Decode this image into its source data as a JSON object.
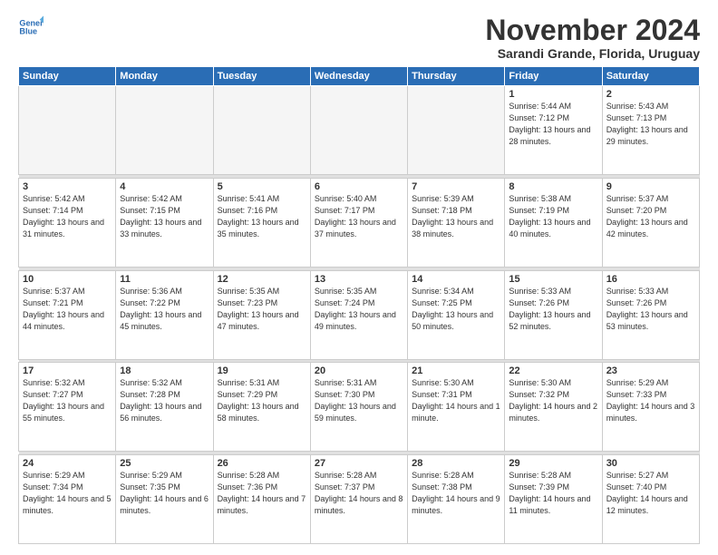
{
  "logo": {
    "line1": "General",
    "line2": "Blue"
  },
  "title": "November 2024",
  "subtitle": "Sarandi Grande, Florida, Uruguay",
  "weekdays": [
    "Sunday",
    "Monday",
    "Tuesday",
    "Wednesday",
    "Thursday",
    "Friday",
    "Saturday"
  ],
  "weeks": [
    [
      {
        "day": "",
        "empty": true
      },
      {
        "day": "",
        "empty": true
      },
      {
        "day": "",
        "empty": true
      },
      {
        "day": "",
        "empty": true
      },
      {
        "day": "",
        "empty": true
      },
      {
        "day": "1",
        "sunrise": "5:44 AM",
        "sunset": "7:12 PM",
        "daylight": "13 hours and 28 minutes."
      },
      {
        "day": "2",
        "sunrise": "5:43 AM",
        "sunset": "7:13 PM",
        "daylight": "13 hours and 29 minutes."
      }
    ],
    [
      {
        "day": "3",
        "sunrise": "5:42 AM",
        "sunset": "7:14 PM",
        "daylight": "13 hours and 31 minutes."
      },
      {
        "day": "4",
        "sunrise": "5:42 AM",
        "sunset": "7:15 PM",
        "daylight": "13 hours and 33 minutes."
      },
      {
        "day": "5",
        "sunrise": "5:41 AM",
        "sunset": "7:16 PM",
        "daylight": "13 hours and 35 minutes."
      },
      {
        "day": "6",
        "sunrise": "5:40 AM",
        "sunset": "7:17 PM",
        "daylight": "13 hours and 37 minutes."
      },
      {
        "day": "7",
        "sunrise": "5:39 AM",
        "sunset": "7:18 PM",
        "daylight": "13 hours and 38 minutes."
      },
      {
        "day": "8",
        "sunrise": "5:38 AM",
        "sunset": "7:19 PM",
        "daylight": "13 hours and 40 minutes."
      },
      {
        "day": "9",
        "sunrise": "5:37 AM",
        "sunset": "7:20 PM",
        "daylight": "13 hours and 42 minutes."
      }
    ],
    [
      {
        "day": "10",
        "sunrise": "5:37 AM",
        "sunset": "7:21 PM",
        "daylight": "13 hours and 44 minutes."
      },
      {
        "day": "11",
        "sunrise": "5:36 AM",
        "sunset": "7:22 PM",
        "daylight": "13 hours and 45 minutes."
      },
      {
        "day": "12",
        "sunrise": "5:35 AM",
        "sunset": "7:23 PM",
        "daylight": "13 hours and 47 minutes."
      },
      {
        "day": "13",
        "sunrise": "5:35 AM",
        "sunset": "7:24 PM",
        "daylight": "13 hours and 49 minutes."
      },
      {
        "day": "14",
        "sunrise": "5:34 AM",
        "sunset": "7:25 PM",
        "daylight": "13 hours and 50 minutes."
      },
      {
        "day": "15",
        "sunrise": "5:33 AM",
        "sunset": "7:26 PM",
        "daylight": "13 hours and 52 minutes."
      },
      {
        "day": "16",
        "sunrise": "5:33 AM",
        "sunset": "7:26 PM",
        "daylight": "13 hours and 53 minutes."
      }
    ],
    [
      {
        "day": "17",
        "sunrise": "5:32 AM",
        "sunset": "7:27 PM",
        "daylight": "13 hours and 55 minutes."
      },
      {
        "day": "18",
        "sunrise": "5:32 AM",
        "sunset": "7:28 PM",
        "daylight": "13 hours and 56 minutes."
      },
      {
        "day": "19",
        "sunrise": "5:31 AM",
        "sunset": "7:29 PM",
        "daylight": "13 hours and 58 minutes."
      },
      {
        "day": "20",
        "sunrise": "5:31 AM",
        "sunset": "7:30 PM",
        "daylight": "13 hours and 59 minutes."
      },
      {
        "day": "21",
        "sunrise": "5:30 AM",
        "sunset": "7:31 PM",
        "daylight": "14 hours and 1 minute."
      },
      {
        "day": "22",
        "sunrise": "5:30 AM",
        "sunset": "7:32 PM",
        "daylight": "14 hours and 2 minutes."
      },
      {
        "day": "23",
        "sunrise": "5:29 AM",
        "sunset": "7:33 PM",
        "daylight": "14 hours and 3 minutes."
      }
    ],
    [
      {
        "day": "24",
        "sunrise": "5:29 AM",
        "sunset": "7:34 PM",
        "daylight": "14 hours and 5 minutes."
      },
      {
        "day": "25",
        "sunrise": "5:29 AM",
        "sunset": "7:35 PM",
        "daylight": "14 hours and 6 minutes."
      },
      {
        "day": "26",
        "sunrise": "5:28 AM",
        "sunset": "7:36 PM",
        "daylight": "14 hours and 7 minutes."
      },
      {
        "day": "27",
        "sunrise": "5:28 AM",
        "sunset": "7:37 PM",
        "daylight": "14 hours and 8 minutes."
      },
      {
        "day": "28",
        "sunrise": "5:28 AM",
        "sunset": "7:38 PM",
        "daylight": "14 hours and 9 minutes."
      },
      {
        "day": "29",
        "sunrise": "5:28 AM",
        "sunset": "7:39 PM",
        "daylight": "14 hours and 11 minutes."
      },
      {
        "day": "30",
        "sunrise": "5:27 AM",
        "sunset": "7:40 PM",
        "daylight": "14 hours and 12 minutes."
      }
    ]
  ]
}
